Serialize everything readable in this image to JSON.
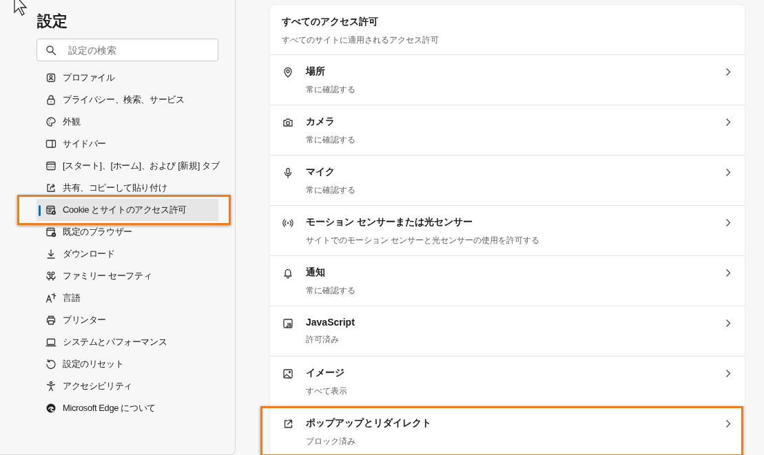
{
  "sidebar": {
    "title": "設定",
    "search": {
      "placeholder": "設定の検索"
    },
    "items": [
      {
        "label": "プロファイル",
        "selected": false,
        "highlighted": false
      },
      {
        "label": "プライバシー、検索、サービス",
        "selected": false,
        "highlighted": false
      },
      {
        "label": "外観",
        "selected": false,
        "highlighted": false
      },
      {
        "label": "サイドバー",
        "selected": false,
        "highlighted": false
      },
      {
        "label": "[スタート]、[ホーム]、および [新規] タブ",
        "selected": false,
        "highlighted": false
      },
      {
        "label": "共有、コピーして貼り付け",
        "selected": false,
        "highlighted": false
      },
      {
        "label": "Cookie とサイトのアクセス許可",
        "selected": true,
        "highlighted": true
      },
      {
        "label": "既定のブラウザー",
        "selected": false,
        "highlighted": false
      },
      {
        "label": "ダウンロード",
        "selected": false,
        "highlighted": false
      },
      {
        "label": "ファミリー セーフティ",
        "selected": false,
        "highlighted": false
      },
      {
        "label": "言語",
        "selected": false,
        "highlighted": false
      },
      {
        "label": "プリンター",
        "selected": false,
        "highlighted": false
      },
      {
        "label": "システムとパフォーマンス",
        "selected": false,
        "highlighted": false
      },
      {
        "label": "設定のリセット",
        "selected": false,
        "highlighted": false
      },
      {
        "label": "アクセシビリティ",
        "selected": false,
        "highlighted": false
      },
      {
        "label": "Microsoft Edge について",
        "selected": false,
        "highlighted": false
      }
    ]
  },
  "permissions": {
    "title": "すべてのアクセス許可",
    "subtitle": "すべてのサイトに適用されるアクセス許可",
    "rows": [
      {
        "title": "場所",
        "status": "常に確認する",
        "highlighted": false
      },
      {
        "title": "カメラ",
        "status": "常に確認する",
        "highlighted": false
      },
      {
        "title": "マイク",
        "status": "常に確認する",
        "highlighted": false
      },
      {
        "title": "モーション センサーまたは光センサー",
        "status": "サイトでのモーション センサーと光センサーの使用を許可する",
        "highlighted": false
      },
      {
        "title": "通知",
        "status": "常に確認する",
        "highlighted": false
      },
      {
        "title": "JavaScript",
        "status": "許可済み",
        "highlighted": false
      },
      {
        "title": "イメージ",
        "status": "すべて表示",
        "highlighted": false
      },
      {
        "title": "ポップアップとリダイレクト",
        "status": "ブロック済み",
        "highlighted": true
      }
    ]
  }
}
